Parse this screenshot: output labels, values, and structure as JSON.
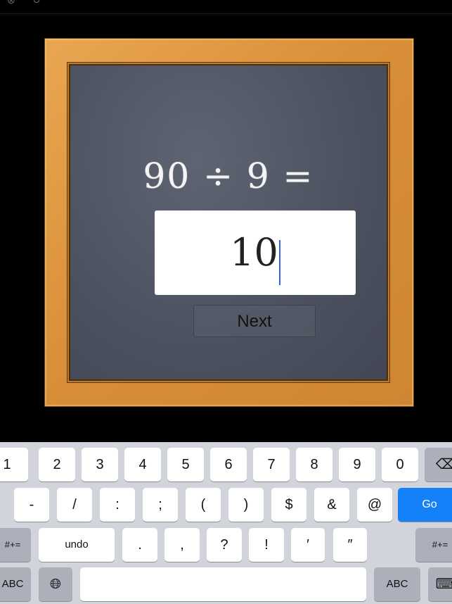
{
  "topbar": {
    "icons": [
      "close-icon",
      "refresh-icon"
    ]
  },
  "problem": {
    "question": "90 ÷ 9 =",
    "answer_value": "10",
    "next_label": "Next"
  },
  "keyboard": {
    "row1": [
      "1",
      "2",
      "3",
      "4",
      "5",
      "6",
      "7",
      "8",
      "9",
      "0"
    ],
    "row2": [
      "-",
      "/",
      ":",
      ";",
      "(",
      ")",
      "$",
      "&",
      "@"
    ],
    "go_label": "Go",
    "row3": [
      ".",
      ",",
      "?",
      "!",
      "′",
      "″"
    ],
    "undo_label": "undo",
    "symbols_label": "#+=",
    "abc_label": "ABC",
    "colors": {
      "go": "#1481f8",
      "caret": "#3366dd"
    }
  }
}
